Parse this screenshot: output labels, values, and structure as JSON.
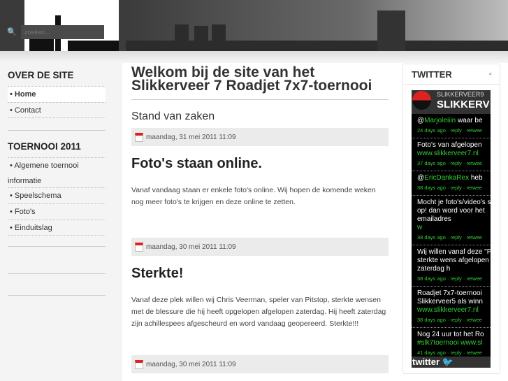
{
  "search": {
    "placeholder": "zoeken..."
  },
  "sidebar": {
    "sections": [
      {
        "title": "OVER DE SITE",
        "items": [
          "Home",
          "Contact"
        ]
      },
      {
        "title": "TOERNOOI 2011",
        "items": [
          "Algemene toernooi informatie",
          "Speelschema",
          "Foto's",
          "Einduitslag"
        ]
      }
    ]
  },
  "main": {
    "title": "Welkom bij de site van het Slikkerveer 7 Roadjet 7x7-toernooi",
    "subtitle": "Stand van zaken",
    "posts": [
      {
        "date": "maandag, 31 mei 2011 11:09",
        "title": "Foto's staan online.",
        "body": "Vanaf vandaag staan er enkele foto's online. Wij hopen de komende weken nog meer foto's te krijgen en deze online te zetten."
      },
      {
        "date": "maandag, 30 mei 2011 11:09",
        "title": "Sterkte!",
        "body": "Vanaf deze plek willen wij Chris Veerman, speler van Pitstop, sterkte wensen met de blessure die hij heeft opgelopen afgelopen zaterdag. Hij heeft zaterdag zijn achillespees afgescheurd en word vandaag geopereerd. Sterkte!!!"
      },
      {
        "date": "maandag, 30 mei 2011 11:09"
      }
    ]
  },
  "twitter": {
    "title": "TWITTER",
    "user": "SLIKKERVEER9",
    "name": "SLIKKERV",
    "footer": "twitter",
    "tweets": [
      {
        "pre": "@",
        "link": "Marjoleiiin",
        "text": " waar be",
        "meta": "24 days ago · reply · retwee"
      },
      {
        "text": "Foto's van afgelopen",
        "link": "www.slikkerveer7.nl",
        "meta": "37 days ago · reply · retwee"
      },
      {
        "pre": "@",
        "link": "EricDankaRex",
        "text": " heb",
        "meta": "38 days ago · reply · retwee"
      },
      {
        "text": "Mocht je foto's/video's stuur ze op! dan word voor het emailadres",
        "link": "w",
        "meta": "38 days ago · reply · retwee"
      },
      {
        "text": "Wij willen vanaf deze \"Pitstop\" sterkte wens afgelopen zaterdag h",
        "meta": "38 days ago · reply · retwee"
      },
      {
        "text": "Roadjet 7x7-toernooi Slikkerveer5 als winn",
        "link": "www.slikkerveer7.nl",
        "meta": "38 days ago · reply · retwee"
      },
      {
        "text": "Nog 24 uur tot het Ro",
        "link": "#slk7toernooi www.sl",
        "meta": "41 days ago · reply · retwee"
      }
    ]
  }
}
